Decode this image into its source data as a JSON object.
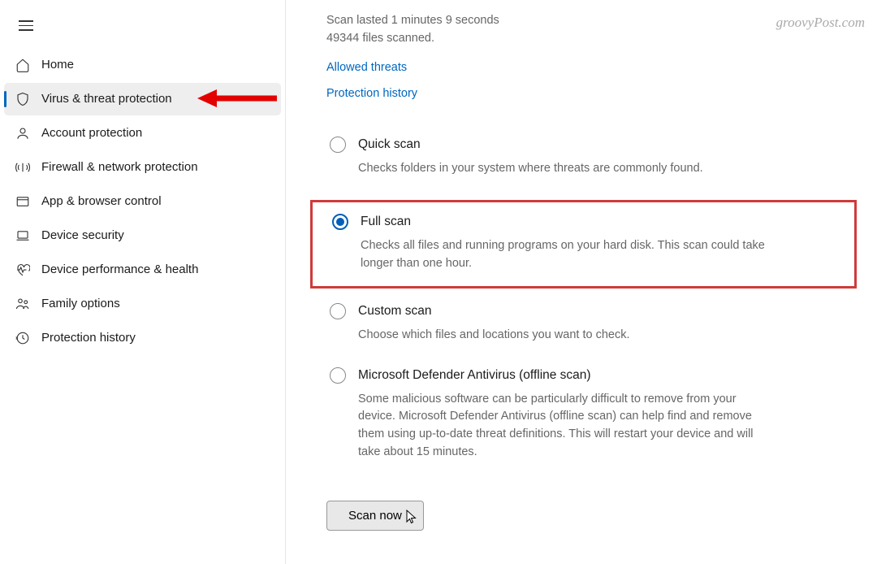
{
  "watermark": "groovyPost.com",
  "sidebar": {
    "items": [
      {
        "label": "Home",
        "icon": "home-icon",
        "active": false
      },
      {
        "label": "Virus & threat protection",
        "icon": "shield-icon",
        "active": true
      },
      {
        "label": "Account protection",
        "icon": "person-icon",
        "active": false
      },
      {
        "label": "Firewall & network protection",
        "icon": "network-icon",
        "active": false
      },
      {
        "label": "App & browser control",
        "icon": "browser-icon",
        "active": false
      },
      {
        "label": "Device security",
        "icon": "laptop-icon",
        "active": false
      },
      {
        "label": "Device performance & health",
        "icon": "heart-icon",
        "active": false
      },
      {
        "label": "Family options",
        "icon": "family-icon",
        "active": false
      },
      {
        "label": "Protection history",
        "icon": "history-icon",
        "active": false
      }
    ]
  },
  "main": {
    "status_line1": "Scan lasted 1 minutes 9 seconds",
    "status_line2": "49344 files scanned.",
    "links": {
      "allowed_threats": "Allowed threats",
      "protection_history": "Protection history"
    },
    "options": [
      {
        "id": "quick",
        "label": "Quick scan",
        "desc": "Checks folders in your system where threats are commonly found.",
        "selected": false
      },
      {
        "id": "full",
        "label": "Full scan",
        "desc": "Checks all files and running programs on your hard disk. This scan could take longer than one hour.",
        "selected": true
      },
      {
        "id": "custom",
        "label": "Custom scan",
        "desc": "Choose which files and locations you want to check.",
        "selected": false
      },
      {
        "id": "offline",
        "label": "Microsoft Defender Antivirus (offline scan)",
        "desc": "Some malicious software can be particularly difficult to remove from your device. Microsoft Defender Antivirus (offline scan) can help find and remove them using up-to-date threat definitions. This will restart your device and will take about 15 minutes.",
        "selected": false
      }
    ],
    "scan_button": "Scan now"
  }
}
